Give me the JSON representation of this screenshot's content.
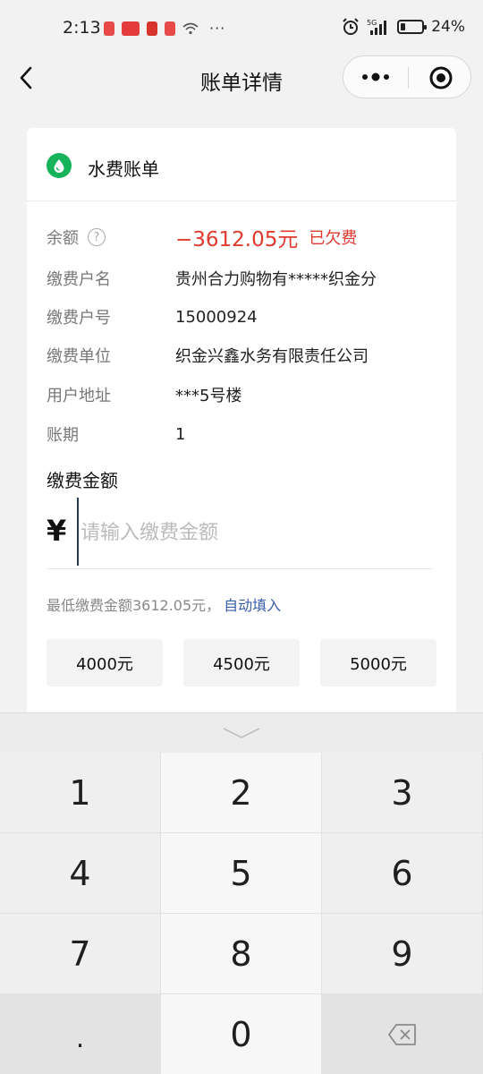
{
  "status_bar": {
    "time": "2:13",
    "network": "5G",
    "battery_percent": "24%",
    "battery_level": 0.24
  },
  "nav": {
    "title": "账单详情"
  },
  "bill": {
    "title": "水费账单",
    "rows": {
      "balance": {
        "label": "余额",
        "value": "−3612.05元",
        "status": "已欠费"
      },
      "payer_name": {
        "label": "缴费户名",
        "value": "贵州合力购物有*****织金分"
      },
      "payer_no": {
        "label": "缴费户号",
        "value": "15000924"
      },
      "unit": {
        "label": "缴费单位",
        "value": "织金兴鑫水务有限责任公司"
      },
      "address": {
        "label": "用户地址",
        "value": "***5号楼"
      },
      "period": {
        "label": "账期",
        "value": "1"
      }
    }
  },
  "payment": {
    "title": "缴费金额",
    "currency": "¥",
    "placeholder": "请输入缴费金额",
    "value": "",
    "min_tip": "最低缴费金额3612.05元，",
    "autofill": "自动填入",
    "quick_amounts": [
      "4000元",
      "4500元",
      "5000元"
    ]
  },
  "keypad": {
    "keys": [
      "1",
      "2",
      "3",
      "4",
      "5",
      "6",
      "7",
      "8",
      "9",
      ".",
      "0"
    ]
  },
  "colors": {
    "accent_green": "#16b35a",
    "arrears_red": "#e0392e",
    "link_blue": "#3a5ea8"
  }
}
